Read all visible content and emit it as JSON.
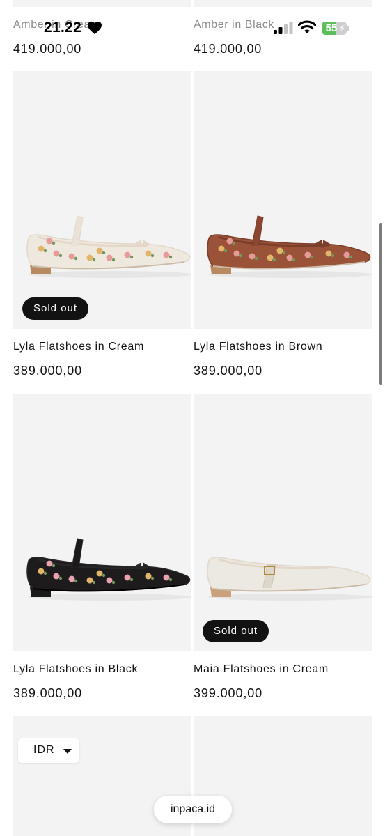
{
  "status_bar": {
    "time": "21.22",
    "battery": "55",
    "battery_level": 0.55,
    "icons": [
      "heart-icon",
      "signal-icon",
      "wifi-icon",
      "battery-icon"
    ]
  },
  "top_row": [
    {
      "name": "Amber in Cream",
      "price": "419.000,00"
    },
    {
      "name": "Amber in Black",
      "price": "419.000,00"
    }
  ],
  "products": [
    {
      "name": "Lyla Flatshoes in Cream",
      "price": "389.000,00",
      "badge": "Sold out",
      "shoe_color": "#efe8df"
    },
    {
      "name": "Lyla Flatshoes in Brown",
      "price": "389.000,00",
      "badge": "",
      "shoe_color": "#9a5238"
    },
    {
      "name": "Lyla Flatshoes in Black",
      "price": "389.000,00",
      "badge": "",
      "shoe_color": "#1d1b1b"
    },
    {
      "name": "Maia Flatshoes in Cream",
      "price": "399.000,00",
      "badge": "Sold out",
      "shoe_color": "#ece9e2"
    }
  ],
  "currency": {
    "selected": "IDR"
  },
  "browser": {
    "url": "inpaca.id"
  },
  "colors": {
    "badge": "#121212",
    "card_bg": "#f3f3f3",
    "battery_fill": "#5ac05a"
  }
}
